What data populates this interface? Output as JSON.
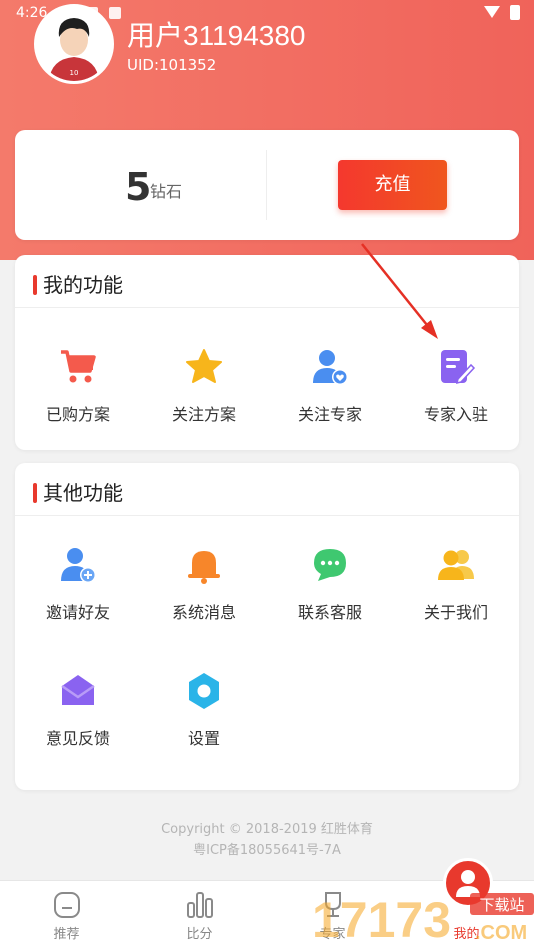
{
  "status_bar": {
    "time": "4:26"
  },
  "profile": {
    "username": "用户31194380",
    "uid": "UID:101352",
    "avatar_number": "10"
  },
  "wallet": {
    "diamond_count": "5",
    "diamond_unit": "钻石",
    "recharge_label": "充值"
  },
  "my_functions": {
    "title": "我的功能",
    "items": [
      {
        "label": "已购方案",
        "icon": "cart-icon",
        "color": "#f45a4c"
      },
      {
        "label": "关注方案",
        "icon": "star-icon",
        "color": "#f7b51b"
      },
      {
        "label": "关注专家",
        "icon": "user-heart-icon",
        "color": "#4a8ef0"
      },
      {
        "label": "专家入驻",
        "icon": "edit-doc-icon",
        "color": "#8a63f0"
      }
    ]
  },
  "other_functions": {
    "title": "其他功能",
    "items": [
      {
        "label": "邀请好友",
        "icon": "add-user-icon",
        "color": "#4a8ef0"
      },
      {
        "label": "系统消息",
        "icon": "bell-icon",
        "color": "#f7862a"
      },
      {
        "label": "联系客服",
        "icon": "chat-icon",
        "color": "#3fc870"
      },
      {
        "label": "关于我们",
        "icon": "users-icon",
        "color": "#f7b51b"
      },
      {
        "label": "意见反馈",
        "icon": "mail-icon",
        "color": "#8a63f0"
      },
      {
        "label": "设置",
        "icon": "gear-icon",
        "color": "#2ab4e8"
      }
    ]
  },
  "footer": {
    "copyright": "Copyright © 2018-2019 红胜体育",
    "icp": "粤ICP备18055641号-7A"
  },
  "tabbar": [
    {
      "label": "推荐",
      "icon": "home-icon"
    },
    {
      "label": "比分",
      "icon": "bar-chart-icon"
    },
    {
      "label": "专家",
      "icon": "trophy-icon"
    },
    {
      "label": "我的",
      "icon": "person-icon",
      "active": true
    }
  ],
  "watermark": {
    "brand": "17173",
    "tag": "下载站",
    "domain": ".COM"
  },
  "colors": {
    "accent": "#e8392d",
    "header": "#f0635a"
  }
}
